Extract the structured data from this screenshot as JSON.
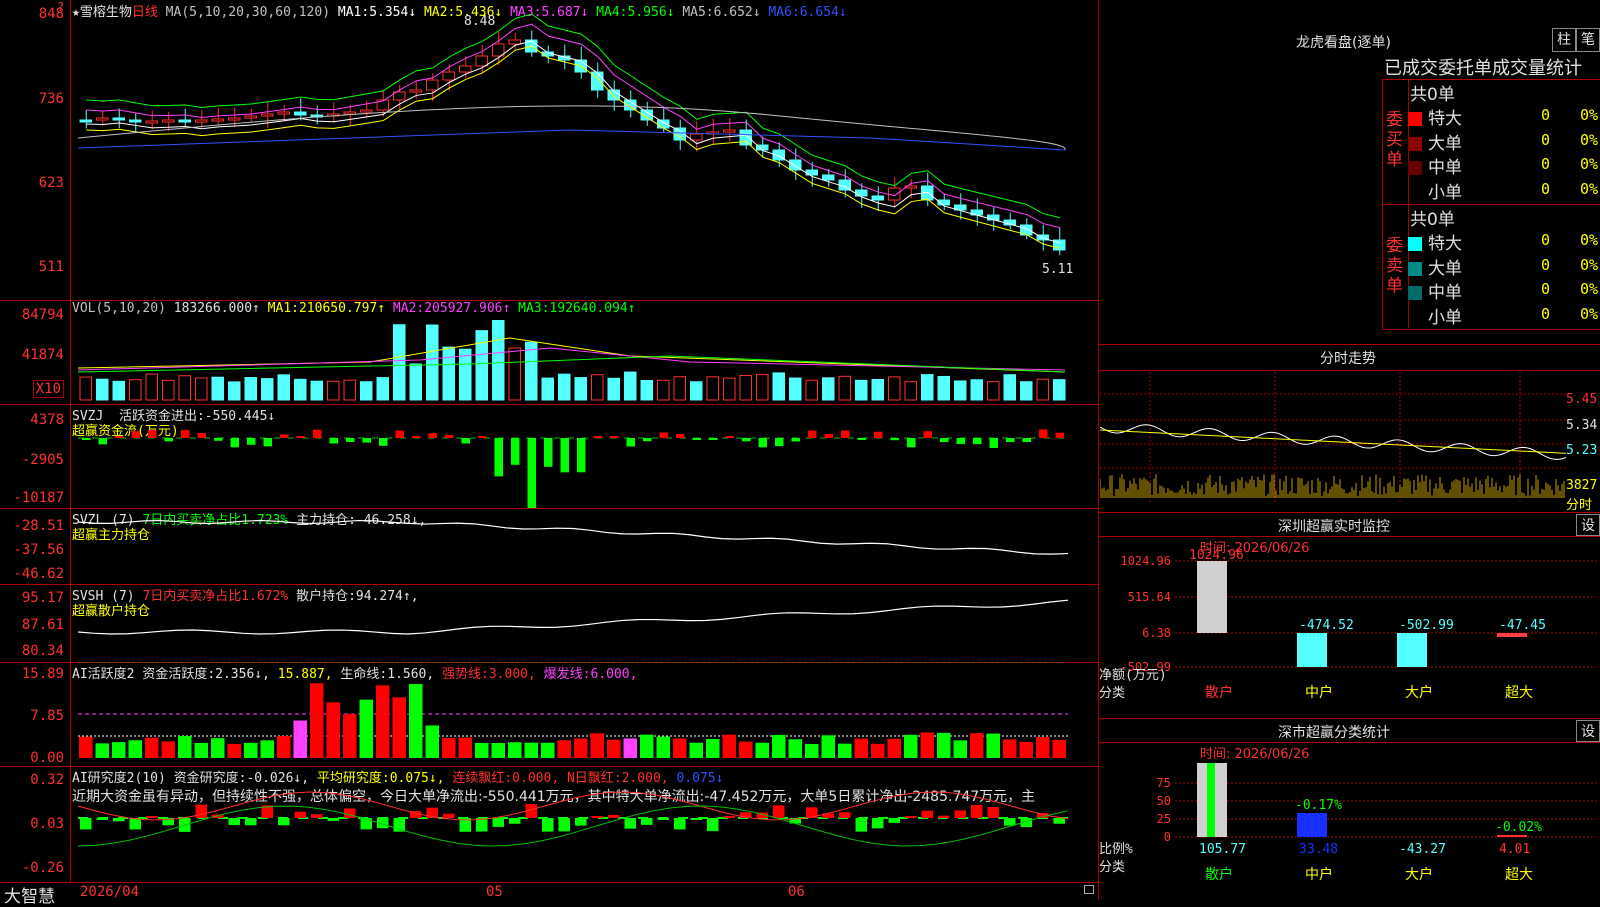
{
  "main": {
    "stock_name": "★雪榕生物",
    "period": "日线",
    "ma_header": "MA(5,10,20,30,60,120)",
    "ma": [
      {
        "label": "MA1:",
        "value": "5.354↓",
        "color": "#ffffff"
      },
      {
        "label": "MA2:",
        "value": "5.436↓",
        "color": "#ffff00"
      },
      {
        "label": "MA3:",
        "value": "5.687↓",
        "color": "#ff40ff"
      },
      {
        "label": "MA4:",
        "value": "5.956↓",
        "color": "#00ff00"
      },
      {
        "label": "MA5:",
        "value": "6.652↓",
        "color": "#c0c0c0"
      },
      {
        "label": "MA6:",
        "value": "6.654↓",
        "color": "#3050ff"
      }
    ],
    "y_ticks": [
      "848",
      "736",
      "623",
      "511"
    ],
    "high_label": "8.48",
    "low_label": "5.11",
    "corner_mark": "?"
  },
  "vol": {
    "header": "VOL(5,10,20)",
    "value": "183266.000↑",
    "ma": [
      {
        "label": "MA1:",
        "value": "210650.797↑",
        "color": "#ffff00"
      },
      {
        "label": "MA2:",
        "value": "205927.906↑",
        "color": "#ff40ff"
      },
      {
        "label": "MA3:",
        "value": "192640.094↑",
        "color": "#00ff00"
      }
    ],
    "y_ticks": [
      "84794",
      "41874"
    ],
    "unit": "X10"
  },
  "svzj": {
    "name": "SVZJ",
    "label": "活跃资金进出:",
    "value": "-550.445↓",
    "sub": "超赢资金流(万元)",
    "y_ticks": [
      "4378",
      "-2905",
      "-10187"
    ]
  },
  "svzl": {
    "name": "SVZL",
    "period": "(7)",
    "ratio": "7日内买卖净占比1.723%",
    "label": "主力持仓:",
    "value": "-46.258↓,",
    "sub": "超赢主力持仓",
    "y_ticks": [
      "-28.51",
      "-37.56",
      "-46.62"
    ]
  },
  "svsh": {
    "name": "SVSH",
    "period": "(7)",
    "ratio": "7日内买卖净占比1.672%",
    "label": "散户持仓:",
    "value": "94.274↑,",
    "sub": "超赢散户持仓",
    "y_ticks": [
      "95.17",
      "87.61",
      "80.34"
    ]
  },
  "ai2": {
    "name": "AI活跃度2",
    "label": "资金活跃度:",
    "value": "2.356↓,",
    "v2": "15.887,",
    "life": "生命线:1.560,",
    "strong": "强势线:3.000,",
    "burst": "爆发线:6.000,",
    "y_ticks": [
      "15.89",
      "7.85",
      "0.00"
    ]
  },
  "ai_research": {
    "name": "AI研究度2(10)",
    "label": "资金研究度:",
    "value": "-0.026↓,",
    "avg": "平均研究度:0.075↓,",
    "bonus": "连续飘红:0.000,",
    "nday": "N日飘红:2.000,",
    "last": "0.075↓",
    "commentary": "近期大资金虽有异动，但持续性不强，总体偏空，今日大单净流出:-550.441万元，其中特大单净流出:-47.452万元，大单5日累计净出-2485.747万元，主",
    "y_ticks": [
      "0.32",
      "0.03",
      "-0.26"
    ]
  },
  "footer": {
    "brand": "大智慧",
    "dates": [
      "2026/04",
      "05",
      "06"
    ]
  },
  "right": {
    "lhb": {
      "title": "龙虎看盘(逐单)",
      "tab1": "柱",
      "tab2": "笔",
      "subtitle": "已成交委托单成交量统计",
      "buy_label": "委买单",
      "sell_label": "委卖单",
      "buy_total": "共0单",
      "sell_total": "共0单",
      "buy_rows": [
        {
          "name": "特大",
          "count": "0",
          "pct": "0%",
          "color": "#ff0000"
        },
        {
          "name": "大单",
          "count": "0",
          "pct": "0%",
          "color": "#8b0000"
        },
        {
          "name": "中单",
          "count": "0",
          "pct": "0%",
          "color": "#6b0000"
        },
        {
          "name": "小单",
          "count": "0",
          "pct": "0%",
          "color": ""
        }
      ],
      "sell_rows": [
        {
          "name": "特大",
          "count": "0",
          "pct": "0%",
          "color": "#00ffff"
        },
        {
          "name": "大单",
          "count": "0",
          "pct": "0%",
          "color": "#008b8b"
        },
        {
          "name": "中单",
          "count": "0",
          "pct": "0%",
          "color": "#006b6b"
        },
        {
          "name": "小单",
          "count": "0",
          "pct": "0%",
          "color": ""
        }
      ]
    },
    "fenshi": {
      "title": "分时走势",
      "y_ticks": [
        "5.45",
        "5.34",
        "5.23"
      ],
      "vol_tick": "3827",
      "vol_unit": "分时"
    },
    "sz_monitor": {
      "title": "深圳超赢实时监控",
      "settings": "设",
      "time": "时间: 2026/06/26",
      "y_ticks": [
        "1024.96",
        "515.64",
        "6.38",
        "-502.99"
      ],
      "y_label": "净额(万元)",
      "x_label": "分类",
      "categories": [
        "散户",
        "中户",
        "大户",
        "超大"
      ],
      "values": [
        "1024.96",
        "-474.52",
        "-502.99",
        "-47.45"
      ]
    },
    "sz_class": {
      "title": "深市超赢分类统计",
      "settings": "设",
      "time": "时间: 2026/06/26",
      "y_ticks": [
        "75",
        "50",
        "25",
        "0"
      ],
      "y_label": "比例%",
      "x_label": "分类",
      "categories": [
        "散户",
        "中户",
        "大户",
        "超大"
      ],
      "values": [
        "105.77",
        "33.48",
        "-43.27",
        "4.01"
      ],
      "top_labels": [
        "",
        "-0.17%",
        "",
        "-0.02%"
      ]
    }
  }
}
